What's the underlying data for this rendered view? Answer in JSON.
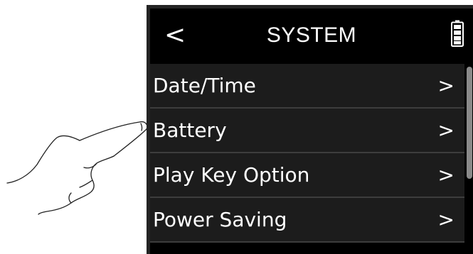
{
  "header": {
    "back_glyph": "<",
    "title": "SYSTEM",
    "battery_icon": "battery-icon"
  },
  "menu": {
    "items": [
      {
        "label": "Date/Time",
        "chevron": ">"
      },
      {
        "label": "Battery",
        "chevron": ">"
      },
      {
        "label": "Play Key Option",
        "chevron": ">"
      },
      {
        "label": "Power Saving",
        "chevron": ">"
      }
    ]
  },
  "scroll": {
    "position_fraction": 0.0,
    "visible_fraction": 0.62
  },
  "colors": {
    "screen_bg": "#000000",
    "item_bg": "#1c1c1c",
    "text": "#ffffff",
    "divider": "#3d3d3d",
    "scroll_thumb": "#8a8a8a"
  },
  "illustration": {
    "icon": "pointing-hand-icon"
  }
}
